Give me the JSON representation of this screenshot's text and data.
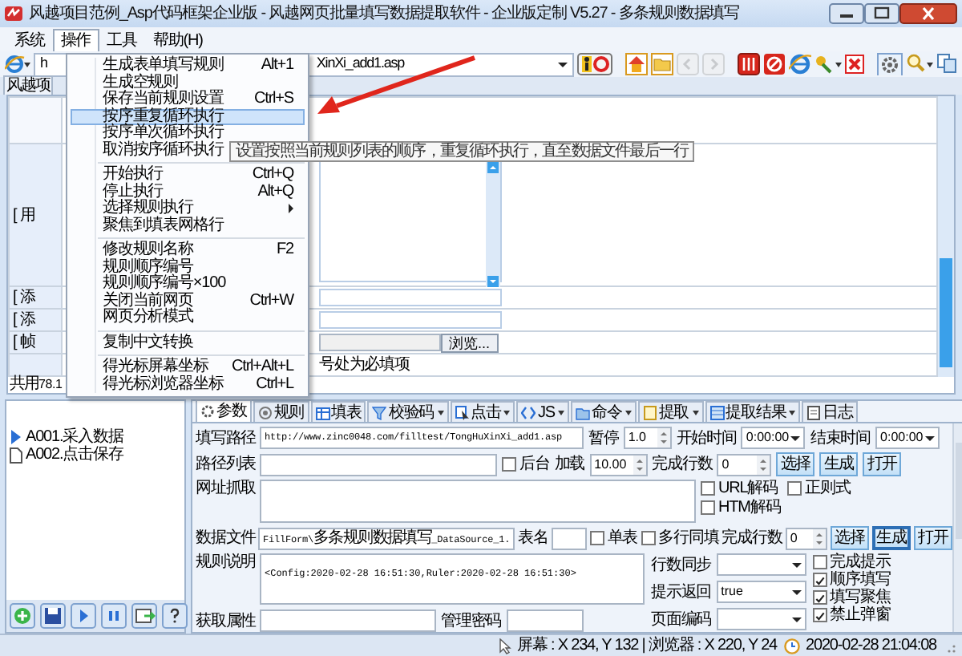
{
  "window": {
    "title": "风越项目范例_Asp代码框架企业版 - 风越网页批量填写数据提取软件 - 企业版定制 V5.27 - 多条规则数据填写"
  },
  "menu_bar": [
    {
      "label": "系统",
      "selected": false
    },
    {
      "label": "操作",
      "selected": true
    },
    {
      "label": "工具",
      "selected": false
    },
    {
      "label": "帮助(H)",
      "selected": false
    }
  ],
  "address": {
    "value_start": "h",
    "value_end": "XinXi_add1.asp"
  },
  "toolbar": [
    {
      "kind": "run",
      "disabled": false
    },
    {
      "kind": "home",
      "disabled": false
    },
    {
      "kind": "folder",
      "disabled": false
    },
    {
      "kind": "back",
      "disabled": true
    },
    {
      "kind": "forward",
      "disabled": true
    },
    {
      "kind": "tool",
      "disabled": false
    },
    {
      "kind": "stop",
      "disabled": false
    },
    {
      "kind": "browser",
      "disabled": false
    },
    {
      "kind": "key",
      "disabled": false
    },
    {
      "kind": "close",
      "disabled": false
    },
    {
      "kind": "gear",
      "disabled": false
    },
    {
      "kind": "search",
      "disabled": false
    },
    {
      "kind": "copy",
      "disabled": false
    }
  ],
  "page_tab": {
    "label": "风越项"
  },
  "web_form": {
    "row_labels": [
      "[ 用",
      "[ 添",
      "[ 添",
      "[ 帧"
    ],
    "browse_button": "浏览...",
    "note": "号处为必填项"
  },
  "page_status": "共用78.1",
  "dropdown_menu": [
    {
      "kind": "item",
      "label": "生成表单填写规则",
      "shortcut": "Alt+1",
      "selected": false
    },
    {
      "kind": "item",
      "label": "生成空规则",
      "selected": false
    },
    {
      "kind": "item",
      "label": "保存当前规则设置",
      "shortcut": "Ctrl+S",
      "selected": false
    },
    {
      "kind": "item",
      "label": "按序重复循环执行",
      "selected": true
    },
    {
      "kind": "item",
      "label": "按序单次循环执行",
      "selected": false
    },
    {
      "kind": "item",
      "label": "取消按序循环执行",
      "selected": false
    },
    {
      "kind": "separator"
    },
    {
      "kind": "item",
      "label": "开始执行",
      "shortcut": "Ctrl+Q",
      "selected": false
    },
    {
      "kind": "item",
      "label": "停止执行",
      "shortcut": "Alt+Q",
      "selected": false
    },
    {
      "kind": "submenu",
      "label": "选择规则执行",
      "selected": false
    },
    {
      "kind": "item",
      "label": "聚焦到填表网格行",
      "selected": false
    },
    {
      "kind": "separator"
    },
    {
      "kind": "item",
      "label": "修改规则名称",
      "shortcut": "F2",
      "selected": false
    },
    {
      "kind": "item",
      "label": "规则顺序编号",
      "selected": false
    },
    {
      "kind": "item",
      "label": "规则顺序编号×100",
      "selected": false
    },
    {
      "kind": "item",
      "label": "关闭当前网页",
      "shortcut": "Ctrl+W",
      "selected": false
    },
    {
      "kind": "item",
      "label": "网页分析模式",
      "selected": false
    },
    {
      "kind": "separator"
    },
    {
      "kind": "item",
      "label": "复制中文转换",
      "selected": false
    },
    {
      "kind": "separator"
    },
    {
      "kind": "item",
      "label": "得光标屏幕坐标",
      "shortcut": "Ctrl+Alt+L",
      "selected": false
    },
    {
      "kind": "item",
      "label": "得光标浏览器坐标",
      "shortcut": "Ctrl+L",
      "selected": false
    }
  ],
  "tooltip": "设置按照当前规则列表的顺序，重复循环执行，直至数据文件最后一行",
  "rules": [
    {
      "label": "A001.采入数据",
      "active": true
    },
    {
      "label": "A002.点击保存",
      "active": false
    }
  ],
  "rule_tabs": [
    {
      "label": "参数",
      "selected": true,
      "has_menu": false
    },
    {
      "label": "规则",
      "selected": false,
      "has_menu": false
    },
    {
      "label": "填表",
      "selected": false,
      "has_menu": false
    },
    {
      "label": "校验码",
      "selected": false,
      "has_menu": true
    },
    {
      "label": "点击",
      "selected": false,
      "has_menu": true
    },
    {
      "label": "JS",
      "selected": false,
      "has_menu": true
    },
    {
      "label": "命令",
      "selected": false,
      "has_menu": true
    },
    {
      "label": "提取",
      "selected": false,
      "has_menu": true
    },
    {
      "label": "提取结果",
      "selected": false,
      "has_menu": true
    },
    {
      "label": "日志",
      "selected": false,
      "has_menu": false
    }
  ],
  "params": {
    "fill_path": {
      "label": "填写路径",
      "value": "http://www.zinc0048.com/filltest/TongHuXinXi_add1.asp"
    },
    "pause": {
      "label": "暂停",
      "value": "1.0"
    },
    "start_time": {
      "label": "开始时间",
      "value": "0:00:00"
    },
    "end_time": {
      "label": "结束时间",
      "value": "0:00:00"
    },
    "path_list": {
      "label": "路径列表"
    },
    "background": {
      "label": "后台",
      "checked": false
    },
    "load": {
      "label": "加载",
      "value": "10.00"
    },
    "done_rows_1": {
      "label": "完成行数",
      "value": "0"
    },
    "buttons_1": [
      {
        "label": "选择",
        "focused": false
      },
      {
        "label": "生成",
        "focused": false
      },
      {
        "label": "打开",
        "focused": false
      }
    ],
    "url_capture": {
      "label": "网址抓取"
    },
    "url_options": [
      {
        "label": "URL解码",
        "checked": false
      },
      {
        "label": "正则式",
        "checked": false
      },
      {
        "label": "HTM解码",
        "checked": false
      }
    ],
    "data_file": {
      "label": "数据文件",
      "value": "FillForm\\多条规则数据填写_DataSource_1."
    },
    "table_name": {
      "label": "表名"
    },
    "single_table": {
      "label": "单表",
      "checked": false
    },
    "multi_row": {
      "label": "多行同填",
      "checked": false
    },
    "done_rows_2": {
      "label": "完成行数",
      "value": "0"
    },
    "buttons_2": [
      {
        "label": "选择",
        "focused": false
      },
      {
        "label": "生成",
        "focused": true
      },
      {
        "label": "打开",
        "focused": false
      }
    ],
    "rule_note": {
      "label": "规则说明",
      "value": "<Config:2020-02-28 16:51:30,Ruler:2020-02-28 16:51:30>"
    },
    "get_attr": {
      "label": "获取属性"
    },
    "admin_password": {
      "label": "管理密码"
    },
    "row_sync": {
      "label": "行数同步"
    },
    "prompt_return": {
      "label": "提示返回",
      "value": "true"
    },
    "page_encoding": {
      "label": "页面编码"
    },
    "options": [
      {
        "label": "完成提示",
        "checked": false
      },
      {
        "label": "顺序填写",
        "checked": true
      },
      {
        "label": "填写聚焦",
        "checked": true
      },
      {
        "label": "禁止弹窗",
        "checked": true
      }
    ]
  },
  "status_bar": {
    "coords": "屏幕 : X 234, Y 132 | 浏览器 : X 220, Y 24",
    "clock": "2020-02-28 21:04:08"
  }
}
